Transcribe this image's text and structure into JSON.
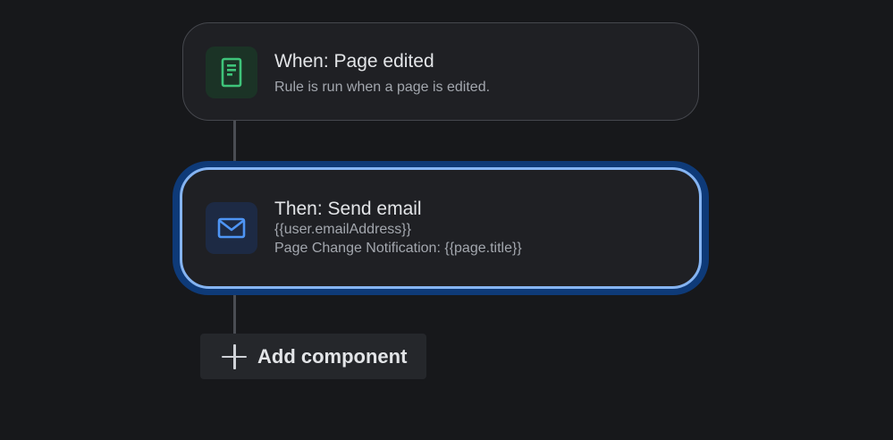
{
  "trigger": {
    "title": "When: Page edited",
    "description": "Rule is run when a page is edited.",
    "icon": "page-document-icon",
    "icon_color": "#3ec47a"
  },
  "action": {
    "title": "Then: Send email",
    "recipient": "{{user.emailAddress}}",
    "subject": "Page Change Notification: {{page.title}}",
    "icon": "mail-envelope-icon",
    "icon_color": "#4e95f5",
    "selected_border_color": "#85b4f2"
  },
  "add_component": {
    "label": "Add component",
    "icon": "plus-icon"
  },
  "colors": {
    "background": "#17181b",
    "card": "#1f2024",
    "connector": "#4a4d53"
  }
}
